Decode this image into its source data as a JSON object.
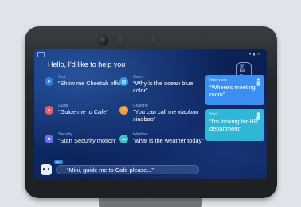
{
  "screen": {
    "greeting": "Hello, I'd like to help you",
    "language_label": "En",
    "cards": [
      {
        "id": "visit",
        "tag": "Visit",
        "text": "“Show me Cheetah office”",
        "icon": "navigation-icon",
        "color": "#2f7be6"
      },
      {
        "id": "query",
        "tag": "Query",
        "text": "“Why is the ocean blue color”",
        "icon": "document-icon",
        "color": "#2fa0e6"
      },
      {
        "id": "guide",
        "tag": "Guide",
        "text": "“Guide me to Cafe”",
        "icon": "location-pin-icon",
        "color": "#e85b6a"
      },
      {
        "id": "chatting",
        "tag": "Chatting",
        "text": "“You can call me xiaobao xiaobao”",
        "icon": "chat-smile-icon",
        "color": "#f29a3d"
      },
      {
        "id": "security",
        "tag": "Security",
        "text": "“Start Security motion”",
        "icon": "shield-icon",
        "color": "#6a6ef0"
      },
      {
        "id": "weather",
        "tag": "Weather",
        "text": "“what is the weather today”",
        "icon": "cloud-icon",
        "color": "#3bc0c8"
      }
    ],
    "panels": [
      {
        "id": "interview",
        "tag": "Interview",
        "text": "“Where's meeting room”",
        "color": "#3b8ff0"
      },
      {
        "id": "visit",
        "tag": "Visit",
        "text": "“I'm looking for HR department”",
        "color": "#2fb7d8"
      }
    ],
    "prompt_text": "“Mini, guide me to Cafe please...”",
    "badge": "Mini"
  }
}
